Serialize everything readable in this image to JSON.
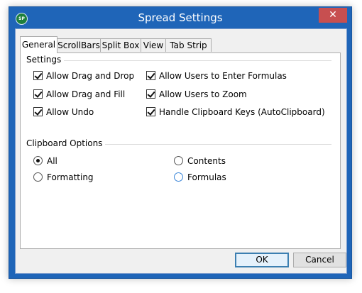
{
  "window": {
    "title": "Spread Settings",
    "icon_text": "SP",
    "close_symbol": "✕",
    "accent_color": "#1f65b8",
    "close_color": "#c74f50"
  },
  "tabs": [
    {
      "label": "General",
      "active": true
    },
    {
      "label": "ScrollBars",
      "active": false
    },
    {
      "label": "Split Box",
      "active": false
    },
    {
      "label": "View",
      "active": false
    },
    {
      "label": "Tab Strip",
      "active": false
    }
  ],
  "settings": {
    "group_label": "Settings",
    "left_options": [
      {
        "label": "Allow Drag and Drop",
        "checked": true
      },
      {
        "label": "Allow Drag and Fill",
        "checked": true
      },
      {
        "label": "Allow Undo",
        "checked": true
      }
    ],
    "right_options": [
      {
        "label": "Allow Users to Enter Formulas",
        "checked": true
      },
      {
        "label": "Allow Users to Zoom",
        "checked": true
      },
      {
        "label": "Handle Clipboard Keys (AutoClipboard)",
        "checked": true
      }
    ]
  },
  "clipboard": {
    "group_label": "Clipboard Options",
    "options": [
      {
        "label": "All",
        "selected": true
      },
      {
        "label": "Contents",
        "selected": false
      },
      {
        "label": "Formatting",
        "selected": false
      },
      {
        "label": "Formulas",
        "selected": false
      }
    ]
  },
  "buttons": {
    "ok": "OK",
    "cancel": "Cancel"
  }
}
